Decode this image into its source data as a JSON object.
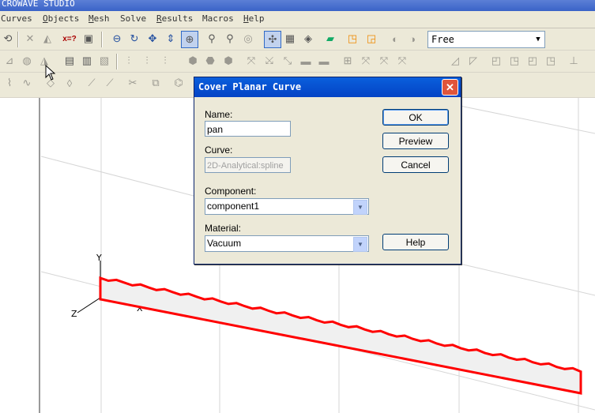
{
  "app": {
    "title": "CROWAVE STUDIO"
  },
  "menu": [
    {
      "label": "Curves",
      "ul": ""
    },
    {
      "label": "Objects",
      "ul": "O"
    },
    {
      "label": "Mesh",
      "ul": "M"
    },
    {
      "label": "Solve",
      "ul": ""
    },
    {
      "label": "Results",
      "ul": "R"
    },
    {
      "label": "Macros",
      "ul": ""
    },
    {
      "label": "Help",
      "ul": "H"
    }
  ],
  "toolbar": {
    "view_mode": "Free"
  },
  "viewport": {
    "axis_y": "Y",
    "axis_x": "X",
    "axis_z": "Z"
  },
  "dialog": {
    "title": "Cover Planar Curve",
    "close_glyph": "✕",
    "name_label": "Name:",
    "name_value": "pan",
    "curve_label": "Curve:",
    "curve_value": "2D-Analytical:spline",
    "component_label": "Component:",
    "component_value": "component1",
    "material_label": "Material:",
    "material_value": "Vacuum",
    "ok": "OK",
    "preview": "Preview",
    "cancel": "Cancel",
    "help": "Help"
  },
  "colors": {
    "curve": "#ff0000",
    "dialog_title": "#0443c5",
    "grid": "#d0d0d0"
  }
}
